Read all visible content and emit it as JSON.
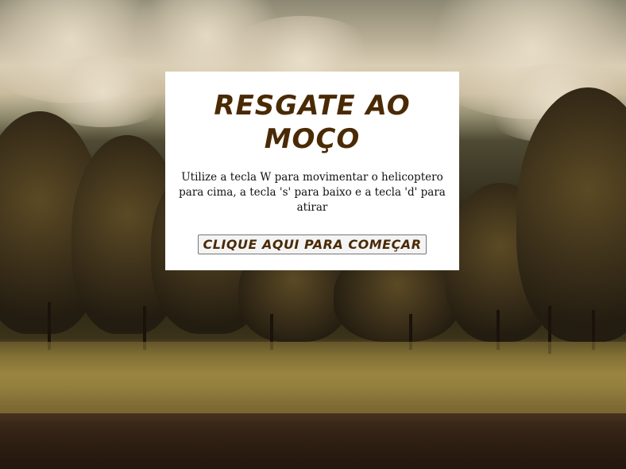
{
  "game": {
    "title": "RESGATE AO MOÇO",
    "instructions": "Utilize a tecla W para movimentar o helicoptero para cima, a tecla 's' para baixo e a tecla 'd' para atirar",
    "start_button_label": "CLIQUE AQUI PARA COMEÇAR"
  },
  "colors": {
    "title_text": "#4a2a05",
    "panel_background": "#ffffff"
  }
}
